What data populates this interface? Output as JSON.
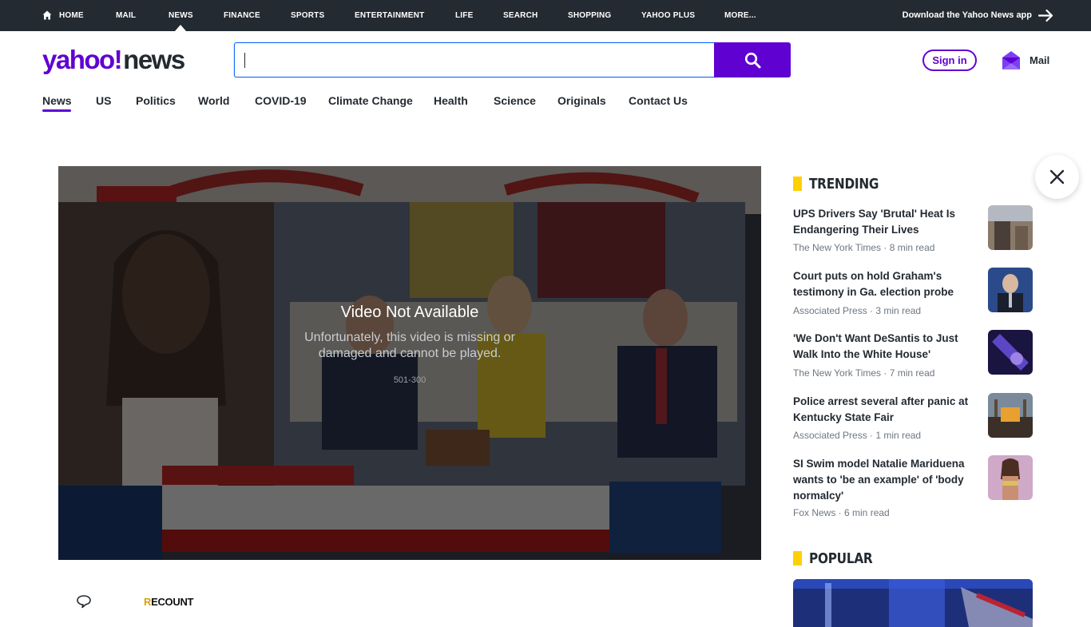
{
  "topnav": {
    "items": [
      "HOME",
      "MAIL",
      "NEWS",
      "FINANCE",
      "SPORTS",
      "ENTERTAINMENT",
      "LIFE",
      "SEARCH",
      "SHOPPING",
      "YAHOO PLUS",
      "MORE..."
    ],
    "active": "NEWS",
    "app_download": "Download the Yahoo News app"
  },
  "header": {
    "logo_brand": "yahoo!",
    "logo_section": "news",
    "search_value": "",
    "signin_label": "Sign in",
    "mail_label": "Mail"
  },
  "subnav": {
    "items": [
      "News",
      "US",
      "Politics",
      "World",
      "COVID-19",
      "Climate Change",
      "Health",
      "Science",
      "Originals",
      "Contact Us"
    ],
    "active": "News"
  },
  "video": {
    "title": "Video Not Available",
    "message": "Unfortunately, this video is missing or damaged and cannot be played.",
    "code": "501-300"
  },
  "article": {
    "source_logo": "RECOUNT"
  },
  "trending": {
    "heading": "TRENDING",
    "items": [
      {
        "title": "UPS Drivers Say 'Brutal' Heat Is Endangering Their Lives",
        "source": "The New York Times",
        "read": "8 min read"
      },
      {
        "title": "Court puts on hold Graham's testimony in Ga. election probe",
        "source": "Associated Press",
        "read": "3 min read"
      },
      {
        "title": "'We Don't Want DeSantis to Just Walk Into the White House'",
        "source": "The New York Times",
        "read": "7 min read"
      },
      {
        "title": "Police arrest several after panic at Kentucky State Fair",
        "source": "Associated Press",
        "read": "1 min read"
      },
      {
        "title": "SI Swim model Natalie Mariduena wants to 'be an example' of 'body normalcy'",
        "source": "Fox News",
        "read": "6 min read"
      }
    ]
  },
  "popular": {
    "heading": "POPULAR"
  },
  "colors": {
    "brand_purple": "#6001d2",
    "topnav_bg": "#232a31",
    "accent_yellow": "#ffd000",
    "search_button": "#5f01d1"
  }
}
